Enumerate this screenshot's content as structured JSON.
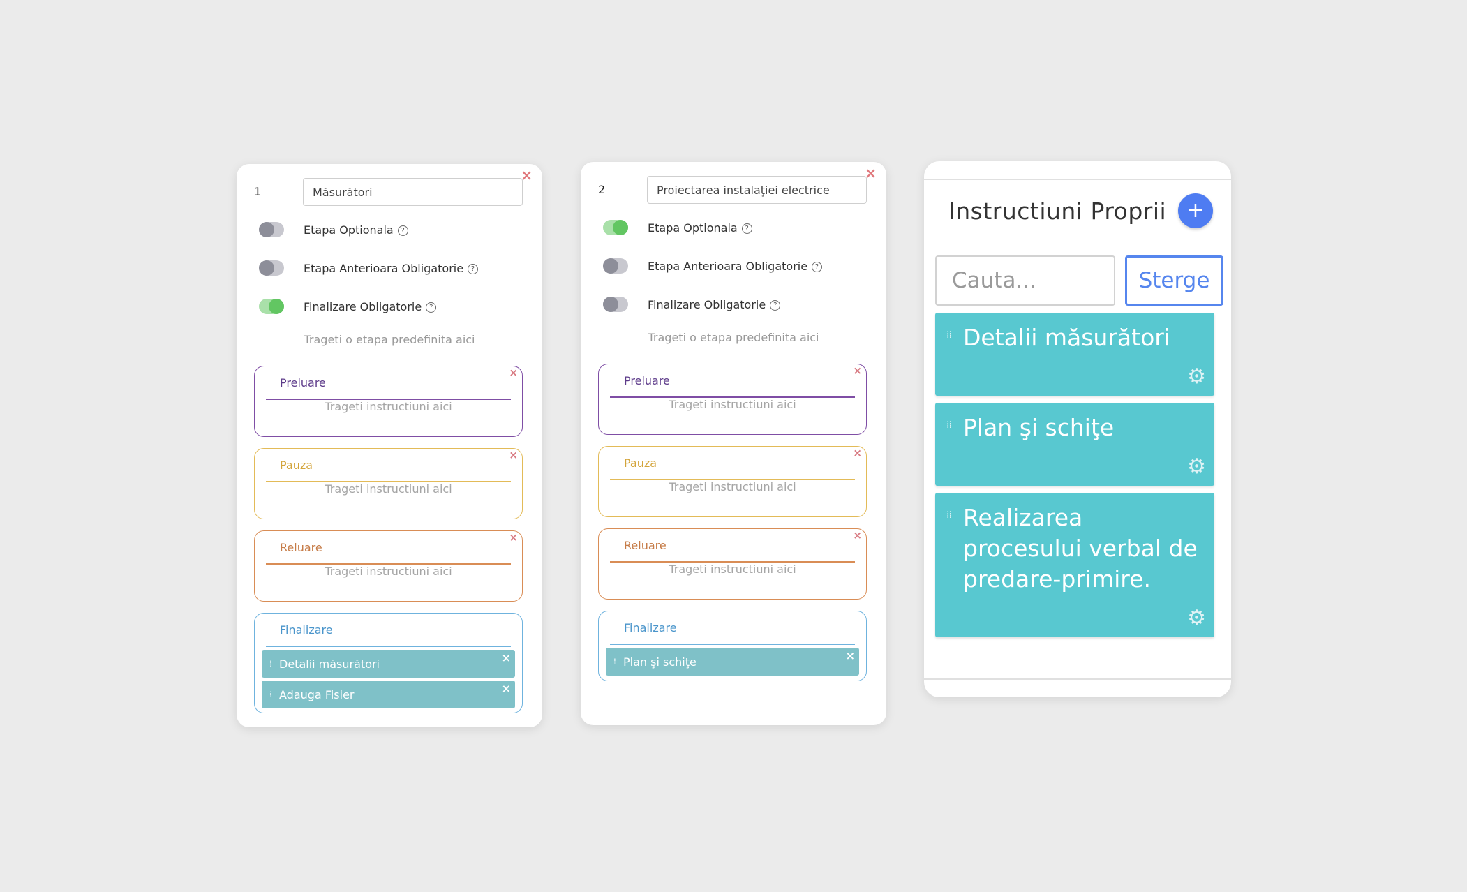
{
  "columns": [
    {
      "number": "1",
      "name_value": "Măsurători",
      "toggles": [
        {
          "label": "Etapa Optionala",
          "on": false
        },
        {
          "label": "Etapa Anterioara Obligatorie",
          "on": false
        },
        {
          "label": "Finalizare Obligatorie",
          "on": true
        }
      ],
      "drop_hint": "Trageti o etapa predefinita aici",
      "sections": {
        "preluare": {
          "title": "Preluare",
          "hint": "Trageti instructiuni aici"
        },
        "pauza": {
          "title": "Pauza",
          "hint": "Trageti instructiuni aici"
        },
        "reluare": {
          "title": "Reluare",
          "hint": "Trageti instructiuni aici"
        },
        "finalizare": {
          "title": "Finalizare",
          "items": [
            "Detalii măsurători",
            "Adauga Fisier"
          ]
        }
      }
    },
    {
      "number": "2",
      "name_value": "Proiectarea instalaţiei electrice",
      "toggles": [
        {
          "label": "Etapa Optionala",
          "on": true
        },
        {
          "label": "Etapa Anterioara Obligatorie",
          "on": false
        },
        {
          "label": "Finalizare Obligatorie",
          "on": false
        }
      ],
      "drop_hint": "Trageti o etapa predefinita aici",
      "sections": {
        "preluare": {
          "title": "Preluare",
          "hint": "Trageti instructiuni aici"
        },
        "pauza": {
          "title": "Pauza",
          "hint": "Trageti instructiuni aici"
        },
        "reluare": {
          "title": "Reluare",
          "hint": "Trageti instructiuni aici"
        },
        "finalizare": {
          "title": "Finalizare",
          "items": [
            "Plan şi schiţe"
          ]
        }
      }
    }
  ],
  "instructions_panel": {
    "title": "Instructiuni Proprii",
    "add_icon": "plus-icon",
    "search_placeholder": "Cauta...",
    "clear_label": "Sterge",
    "cards": [
      "Detalii măsurători",
      "Plan şi schiţe",
      "Realizarea procesului verbal de predare-primire."
    ]
  },
  "icons": {
    "close": "close-icon",
    "help": "help-icon",
    "drag": "drag-handle-icon",
    "settings": "gear-icon"
  },
  "colors": {
    "background": "#ebebeb",
    "toggle_on": "#62c662",
    "preluare": "#7f4ea5",
    "pauza": "#e3bb58",
    "reluare": "#d98d56",
    "finalizare": "#6fb3de",
    "chip": "#7fc1c8",
    "instruction_card": "#58c8d0",
    "accent_blue": "#5686ee"
  }
}
